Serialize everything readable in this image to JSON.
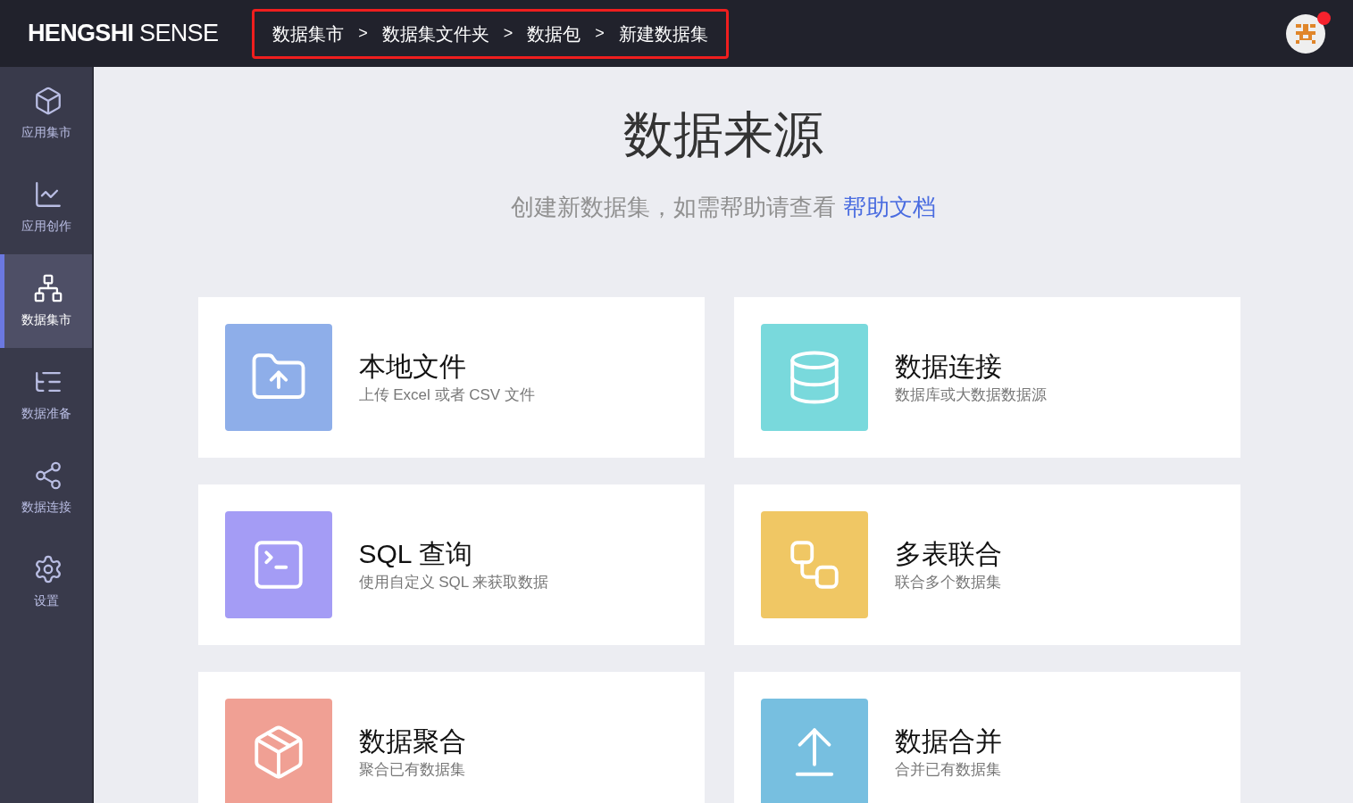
{
  "header": {
    "logo": "**HENGSHI** SENSE",
    "breadcrumb": [
      "数据集市",
      "数据集文件夹",
      "数据包",
      "新建数据集"
    ],
    "breadcrumb_separator": ">",
    "notification": true
  },
  "sidebar": {
    "items": [
      {
        "kind": "market",
        "label": "应用集市",
        "selected": false
      },
      {
        "kind": "create",
        "label": "应用创作",
        "selected": false
      },
      {
        "kind": "dataset",
        "label": "数据集市",
        "selected": true
      },
      {
        "kind": "prepare",
        "label": "数据准备",
        "selected": false
      },
      {
        "kind": "connect",
        "label": "数据连接",
        "selected": false
      },
      {
        "kind": "settings",
        "label": "设置",
        "selected": false
      }
    ]
  },
  "main": {
    "title": "数据来源",
    "subtitle": "创建新数据集，如需帮助请查看",
    "help_link": "帮助文档",
    "sources": [
      {
        "kind": "file",
        "title": "本地文件",
        "description": "上传 Excel 或者 CSV 文件",
        "color": "#8eaee9"
      },
      {
        "kind": "database",
        "title": "数据连接",
        "description": "数据库或大数据数据源",
        "color": "#79d9dc"
      },
      {
        "kind": "sql",
        "title": "SQL 查询",
        "description": "使用自定义 SQL 来获取数据",
        "color": "#a49cf5"
      },
      {
        "kind": "join",
        "title": "多表联合",
        "description": "联合多个数据集",
        "color": "#f0c764"
      },
      {
        "kind": "aggregate",
        "title": "数据聚合",
        "description": "聚合已有数据集",
        "color": "#f0a094"
      },
      {
        "kind": "merge",
        "title": "数据合并",
        "description": "合并已有数据集",
        "color": "#77bfe0"
      }
    ]
  }
}
